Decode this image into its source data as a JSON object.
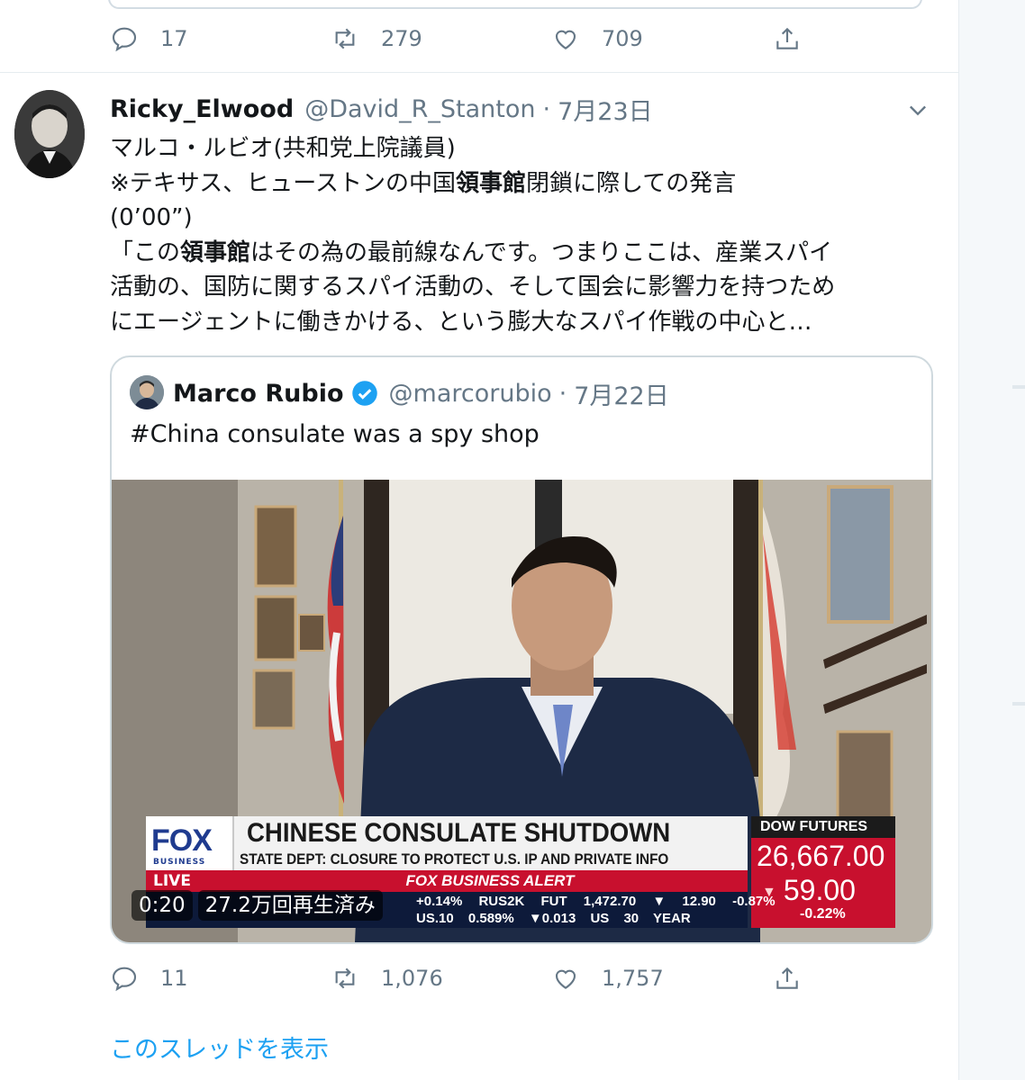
{
  "top_actions": {
    "reply_count": "17",
    "retweet_count": "279",
    "like_count": "709"
  },
  "tweet": {
    "display_name": "Ricky_Elwood",
    "handle": "@David_R_Stanton",
    "separator": "·",
    "date": "7月23日",
    "text_lines": [
      "マルコ・ルビオ(共和党上院議員)",
      "※テキサス、ヒューストンの中国領事館閉鎖に際しての発言",
      "(0’00”)",
      "「この領事館はその為の最前線なんです。つまりここは、産業スパイ",
      "活動の、国防に関するスパイ活動の、そして国会に影響力を持つため",
      "にエージェントに働きかける、という膨大なスパイ作戦の中心と…"
    ]
  },
  "quote": {
    "display_name": "Marco Rubio",
    "handle": "@marcorubio",
    "separator": "·",
    "date": "7月22日",
    "text": "#China consulate was a spy shop"
  },
  "video": {
    "time": "0:20",
    "views": "27.2万回再生済み",
    "logo_text": "FOX",
    "logo_sub": "BUSINESS",
    "live_label": "LIVE",
    "headline": "CHINESE CONSULATE SHUTDOWN",
    "subhead": "STATE DEPT: CLOSURE TO PROTECT U.S. IP AND PRIVATE INFO",
    "alert_bar": "FOX BUSINESS ALERT",
    "dow_label": "DOW FUTURES",
    "dow_value": "26,667.00",
    "dow_change": "59.00",
    "dow_pct": "-0.22%",
    "ticker_top": "+0.14% RUS2K FUT 1,472.70 ▼ 12.90 -0.87%",
    "ticker_bottom": "US.10 0.589% ▼0.013 US 30 YEAR"
  },
  "bottom_actions": {
    "reply_count": "11",
    "retweet_count": "1,076",
    "like_count": "1,757"
  },
  "show_thread": "このスレッドを表示",
  "colors": {
    "link": "#1da1f2",
    "muted": "#657786",
    "border": "#cfd9de",
    "fox_red": "#c8102e"
  }
}
